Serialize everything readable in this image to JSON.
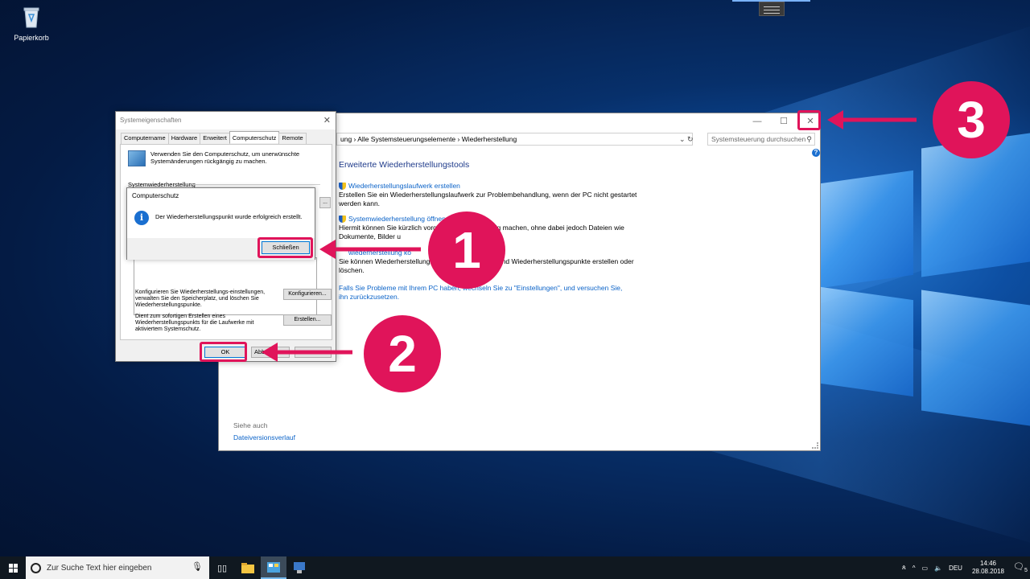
{
  "desktop": {
    "recycle_bin_label": "Papierkorb"
  },
  "control_panel": {
    "address": "ung  ›  Alle Systemsteuerungselemente  ›  Wiederherstellung",
    "search_placeholder": "Systemsteuerung durchsuchen",
    "heading": "Erweiterte Wiederherstellungstools",
    "tools": [
      {
        "link": "Wiederherstellungslaufwerk erstellen",
        "desc": "Erstellen Sie ein Wiederherstellungslaufwerk zur Problembehandlung, wenn der PC nicht gestartet werden kann."
      },
      {
        "link": "Systemwiederherstellung öffnen",
        "desc": "Hiermit können Sie kürzlich vorgen                                  ungen rückgängig machen, ohne dabei jedoch Dateien wie Dokumente, Bilder u"
      },
      {
        "link": "                  wiederherstellung ko",
        "desc": "Sie können Wiederherstellungsei                                 herplatz verwalten und Wiederherstellungspunkte erstellen oder löschen."
      }
    ],
    "settings_link": "Falls Sie Probleme mit Ihrem PC haben, wechseln Sie zu \"Einstellungen\", und versuchen Sie, ihn zurückzusetzen.",
    "see_also": "Siehe auch",
    "see_also_link": "Dateiversionsverlauf"
  },
  "system_properties": {
    "title": "Systemeigenschaften",
    "tabs": [
      "Computername",
      "Hardware",
      "Erweitert",
      "Computerschutz",
      "Remote"
    ],
    "active_tab": "Computerschutz",
    "intro": "Verwenden Sie den Computerschutz, um unerwünschte Systemänderungen rückgängig zu machen.",
    "section_label": "Systemwiederherstellung",
    "configure_text": "Konfigurieren Sie Wiederherstellungs-einstellungen, verwalten Sie den Speicherplatz, und löschen Sie Wiederherstellungspunkte.",
    "configure_button": "Konfigurieren...",
    "create_text": "Dient zum sofortigen Erstellen eines Wiederherstellungspunkts für die Laufwerke mit aktiviertem Systemschutz.",
    "create_button": "Erstellen...",
    "ok_button": "OK",
    "cancel_button": "Abb"
  },
  "message_box": {
    "title": "Computerschutz",
    "text": "Der Wiederherstellungspunkt wurde erfolgreich erstellt.",
    "close_button": "Schließen"
  },
  "annotations": {
    "step1": "1",
    "step2": "2",
    "step3": "3",
    "color": "#e0145a"
  },
  "taskbar": {
    "search_placeholder": "Zur Suche Text hier eingeben",
    "language": "DEU",
    "time": "14:46",
    "date": "28.08.2018",
    "notification_count": "5"
  }
}
